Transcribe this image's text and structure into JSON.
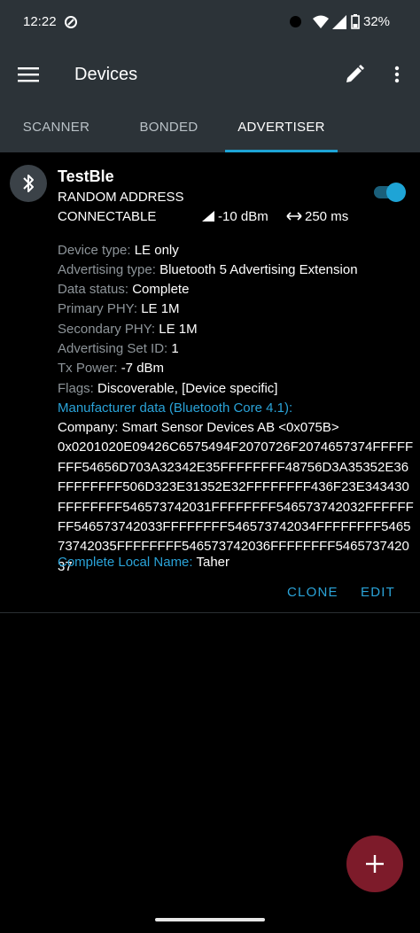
{
  "status_bar": {
    "time": "12:22",
    "battery": "32%"
  },
  "app_bar": {
    "title": "Devices"
  },
  "tabs": [
    {
      "label": "SCANNER",
      "active": false
    },
    {
      "label": "BONDED",
      "active": false
    },
    {
      "label": "ADVERTISER",
      "active": true
    }
  ],
  "device": {
    "name": "TestBle",
    "address_type": "RANDOM ADDRESS",
    "connectable": "CONNECTABLE",
    "tx_power": "-10 dBm",
    "interval": "250 ms",
    "enabled": true,
    "details": [
      {
        "label": "Device type:",
        "value": "LE only"
      },
      {
        "label": "Advertising type:",
        "value": "Bluetooth 5 Advertising Extension"
      },
      {
        "label": "Data status:",
        "value": "Complete"
      },
      {
        "label": "Primary PHY:",
        "value": "LE 1M"
      },
      {
        "label": "Secondary PHY:",
        "value": "LE 1M"
      },
      {
        "label": "Advertising Set ID:",
        "value": "1"
      },
      {
        "label": "Tx Power:",
        "value": "-7 dBm"
      },
      {
        "label": "Flags:",
        "value": "Discoverable, [Device specific]"
      }
    ],
    "manufacturer_label": "Manufacturer data (Bluetooth Core 4.1):",
    "company": "Company: Smart Sensor Devices AB <0x075B>",
    "manufacturer_data": "0x0201020E09426C6575494F2070726F2074657374FFFFFFFF54656D703A32342E35FFFFFFFF48756D3A35352E36FFFFFFFF506D323E31352E32FFFFFFFF436F23E343430FFFFFFFF546573742031FFFFFFFF546573742032FFFFFFFF546573742033FFFFFFFF546573742034FFFFFFFF546573742035FFFFFFFF546573742036FFFFFFFF546573742037",
    "local_name_label": "Complete Local Name:",
    "local_name": "Taher"
  },
  "actions": {
    "clone": "CLONE",
    "edit": "EDIT"
  },
  "colors": {
    "accent": "#1ea4d6",
    "bar": "#2c3338",
    "fab": "#7d1b2a",
    "label": "#8d9499"
  },
  "icons": {
    "menu": "menu-icon",
    "edit": "pencil-icon",
    "more": "more-vert-icon",
    "bluetooth": "bluetooth-icon",
    "fab": "plus-icon"
  }
}
